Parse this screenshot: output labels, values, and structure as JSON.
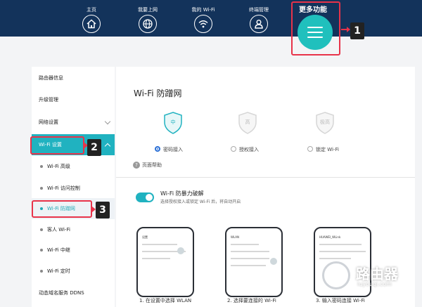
{
  "nav": {
    "items": [
      {
        "label": "主页",
        "icon": "home-icon"
      },
      {
        "label": "我要上网",
        "icon": "globe-icon"
      },
      {
        "label": "我的 Wi-Fi",
        "icon": "wifi-icon"
      },
      {
        "label": "终端管理",
        "icon": "user-icon"
      }
    ],
    "more_label": "更多功能",
    "more_icon": "menu-icon"
  },
  "annotations": {
    "step1": "1",
    "step2": "2",
    "step3": "3"
  },
  "sidebar": {
    "items": [
      {
        "label": "路由器信息"
      },
      {
        "label": "升级管理"
      },
      {
        "label": "网络设置"
      },
      {
        "label": "Wi-Fi 设置"
      },
      {
        "label": "Wi-Fi 高级"
      },
      {
        "label": "Wi-Fi 访问控制"
      },
      {
        "label": "Wi-Fi 防蹭网"
      },
      {
        "label": "客人 Wi-Fi"
      },
      {
        "label": "Wi-Fi 中继"
      },
      {
        "label": "Wi-Fi 定时"
      },
      {
        "label": "动态域名服务 DDNS"
      }
    ]
  },
  "main": {
    "title": "Wi-Fi 防蹭网",
    "levels": [
      {
        "label": "中",
        "option": "密码接入",
        "selected": true
      },
      {
        "label": "高",
        "option": "授权接入",
        "selected": false
      },
      {
        "label": "极高",
        "option": "锁定 Wi-Fi",
        "selected": false
      }
    ],
    "help": "页面帮助",
    "help_icon": "?",
    "brute_force": {
      "title": "Wi-Fi 防暴力破解",
      "desc": "选择授权接入或锁定 Wi-Fi 后，将自动开启",
      "enabled": true
    },
    "steps": [
      {
        "caption": "1. 在设置中选择 WLAN",
        "screen_title": "设置"
      },
      {
        "caption": "2. 选择要连接的 Wi-Fi",
        "screen_title": "WLAN"
      },
      {
        "caption": "3. 输入密码连接 Wi-Fi",
        "screen_title": "HUAWEI_WLink"
      }
    ]
  },
  "watermark": {
    "text": "路由器",
    "sub": "luyouqi.com"
  },
  "colors": {
    "topbar": "#13335b",
    "accent": "#20b2c0",
    "highlight": "#e8334a",
    "radio": "#2a6fd6"
  }
}
